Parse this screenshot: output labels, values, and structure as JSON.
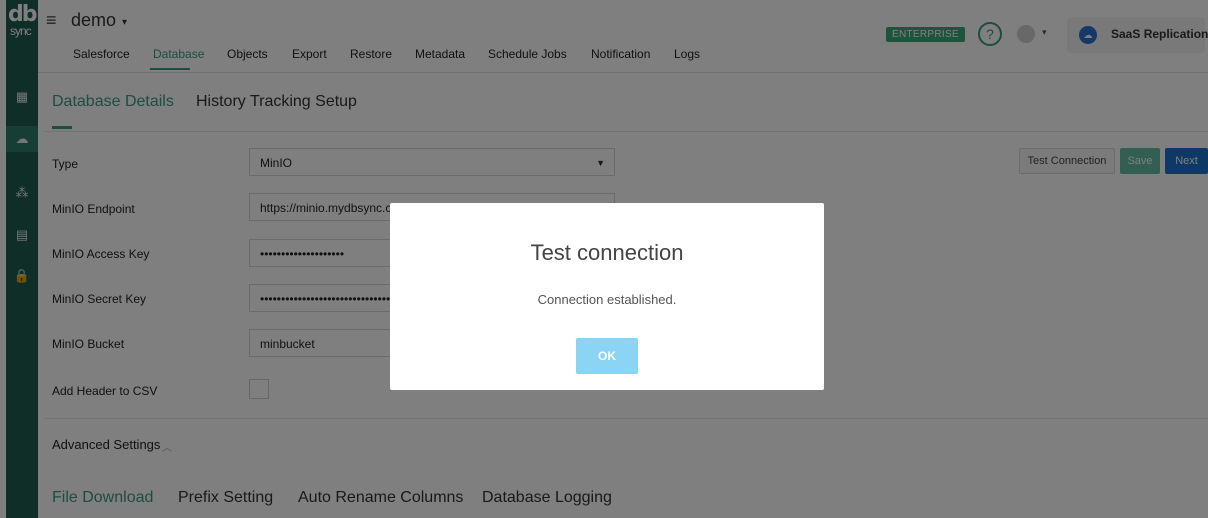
{
  "brand": {
    "logo_main": "db",
    "logo_sub": "sync"
  },
  "sidebar": {
    "icons": [
      {
        "name": "apps-grid-icon",
        "glyph": "▦"
      },
      {
        "name": "salesforce-cloud-icon",
        "glyph": "☁"
      },
      {
        "name": "team-icon",
        "glyph": "⁂"
      },
      {
        "name": "document-icon",
        "glyph": "▤"
      },
      {
        "name": "lock-icon",
        "glyph": "🔒"
      }
    ]
  },
  "header": {
    "menu_icon": "≡",
    "org_name": "demo",
    "org_caret": "▾",
    "nav": [
      "Salesforce",
      "Database",
      "Objects",
      "Export",
      "Restore",
      "Metadata",
      "Schedule Jobs",
      "Notification",
      "Logs"
    ],
    "active_nav": "Database",
    "badge": "ENTERPRISE",
    "help_glyph": "?",
    "avatar_caret": "▾",
    "replication_label": "SaaS Replication",
    "replication_icon_glyph": "☁"
  },
  "tabs": {
    "database_details": "Database Details",
    "history_tracking": "History Tracking Setup"
  },
  "form": {
    "type_label": "Type",
    "type_value": "MinIO",
    "endpoint_label": "MinIO Endpoint",
    "endpoint_value": "https://minio.mydbsync.c",
    "access_key_label": "MinIO Access Key",
    "access_key_value": "••••••••••••••••••••",
    "secret_key_label": "MinIO Secret Key",
    "secret_key_value": "••••••••••••••••••••••••••••••••••",
    "bucket_label": "MinIO Bucket",
    "bucket_value": "minbucket",
    "header_csv_label": "Add Header to CSV"
  },
  "actions": {
    "test_connection": "Test Connection",
    "save": "Save",
    "next": "Next"
  },
  "advanced": {
    "label": "Advanced Settings",
    "chevron": "︿"
  },
  "subtabs": [
    "File Download",
    "Prefix Setting",
    "Auto Rename Columns",
    "Database Logging"
  ],
  "modal": {
    "title": "Test connection",
    "message": "Connection established.",
    "ok_label": "OK"
  },
  "colors": {
    "accent": "#3a9a82",
    "sidebar": "#1f5c4f",
    "primary_button": "#1a73c9",
    "badge": "#38a87c"
  }
}
